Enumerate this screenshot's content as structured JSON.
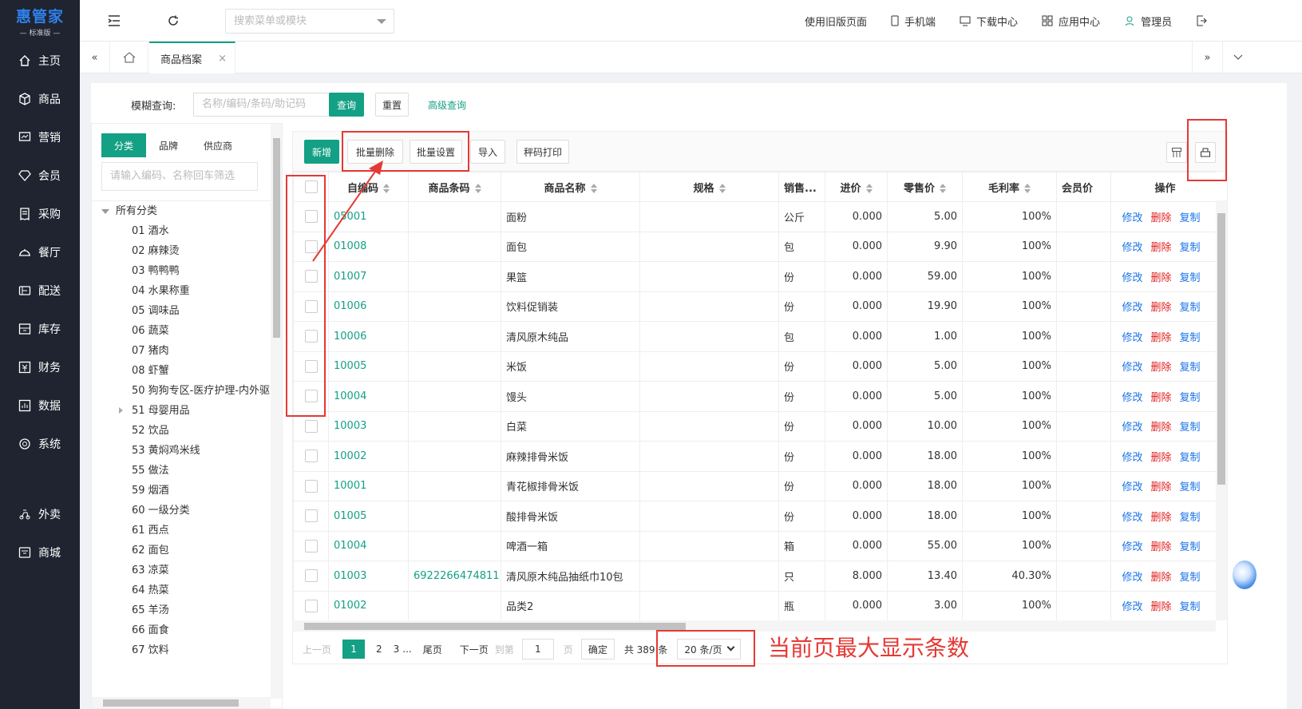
{
  "logo": {
    "main": "惠管家",
    "sub": "— 标准版 —"
  },
  "sidebar": {
    "items": [
      {
        "label": "主页",
        "icon": "home-icon"
      },
      {
        "label": "商品",
        "icon": "box-icon"
      },
      {
        "label": "营销",
        "icon": "chart-icon"
      },
      {
        "label": "会员",
        "icon": "diamond-icon"
      },
      {
        "label": "采购",
        "icon": "receipt-icon"
      },
      {
        "label": "餐厅",
        "icon": "dish-icon"
      },
      {
        "label": "配送",
        "icon": "delivery-icon"
      },
      {
        "label": "库存",
        "icon": "inventory-icon"
      },
      {
        "label": "财务",
        "icon": "finance-icon"
      },
      {
        "label": "数据",
        "icon": "data-icon"
      },
      {
        "label": "系统",
        "icon": "settings-icon"
      }
    ],
    "extra_items": [
      {
        "label": "外卖",
        "icon": "takeout-icon"
      },
      {
        "label": "商城",
        "icon": "mall-icon"
      }
    ]
  },
  "topbar": {
    "menu_search_placeholder": "搜索菜单或模块",
    "old_version": "使用旧版页面",
    "mobile": "手机端",
    "download": "下载中心",
    "apps": "应用中心",
    "user": "管理员"
  },
  "tabs": {
    "active": "商品档案",
    "close": "×"
  },
  "search": {
    "label": "模糊查询:",
    "placeholder": "名称/编码/条码/助记码",
    "query": "查询",
    "reset": "重置",
    "advanced": "高级查询"
  },
  "category_panel": {
    "tabs": [
      "分类",
      "品牌",
      "供应商"
    ],
    "filter_placeholder": "请输入编码、名称回车筛选",
    "root": "所有分类",
    "items": [
      "01 酒水",
      "02 麻辣烫",
      "03 鸭鸭鸭",
      "04 水果称重",
      "05 调味品",
      "06 蔬菜",
      "07 猪肉",
      "08 虾蟹",
      "50 狗狗专区-医疗护理-内外驱",
      "51 母婴用品",
      "52 饮品",
      "53 黄焖鸡米线",
      "55 做法",
      "59 烟酒",
      "60 一级分类",
      "61 西点",
      "62 面包",
      "63 凉菜",
      "64 热菜",
      "65 羊汤",
      "66 面食",
      "67 饮料"
    ]
  },
  "toolbar": {
    "add": "新增",
    "batch_delete": "批量删除",
    "batch_set": "批量设置",
    "import": "导入",
    "scale_print": "秤码打印"
  },
  "table": {
    "headers": {
      "code": "自编码",
      "barcode": "商品条码",
      "name": "商品名称",
      "spec": "规格",
      "unit": "销售...",
      "cost": "进价",
      "price": "零售价",
      "margin": "毛利率",
      "member": "会员价",
      "ops": "操作"
    },
    "ops": {
      "edit": "修改",
      "delete": "删除",
      "copy": "复制"
    },
    "rows": [
      {
        "code": "05001",
        "barcode": "",
        "name": "面粉",
        "spec": "",
        "unit": "公斤",
        "cost": "0.000",
        "price": "5.00",
        "margin": "100%"
      },
      {
        "code": "01008",
        "barcode": "",
        "name": "面包",
        "spec": "",
        "unit": "包",
        "cost": "0.000",
        "price": "9.90",
        "margin": "100%"
      },
      {
        "code": "01007",
        "barcode": "",
        "name": "果篮",
        "spec": "",
        "unit": "份",
        "cost": "0.000",
        "price": "59.00",
        "margin": "100%"
      },
      {
        "code": "01006",
        "barcode": "",
        "name": "饮料促销装",
        "spec": "",
        "unit": "份",
        "cost": "0.000",
        "price": "19.90",
        "margin": "100%"
      },
      {
        "code": "10006",
        "barcode": "",
        "name": "清风原木纯品",
        "spec": "",
        "unit": "包",
        "cost": "0.000",
        "price": "1.00",
        "margin": "100%"
      },
      {
        "code": "10005",
        "barcode": "",
        "name": "米饭",
        "spec": "",
        "unit": "份",
        "cost": "0.000",
        "price": "5.00",
        "margin": "100%"
      },
      {
        "code": "10004",
        "barcode": "",
        "name": "馒头",
        "spec": "",
        "unit": "份",
        "cost": "0.000",
        "price": "5.00",
        "margin": "100%"
      },
      {
        "code": "10003",
        "barcode": "",
        "name": "白菜",
        "spec": "",
        "unit": "份",
        "cost": "0.000",
        "price": "10.00",
        "margin": "100%"
      },
      {
        "code": "10002",
        "barcode": "",
        "name": "麻辣排骨米饭",
        "spec": "",
        "unit": "份",
        "cost": "0.000",
        "price": "18.00",
        "margin": "100%"
      },
      {
        "code": "10001",
        "barcode": "",
        "name": "青花椒排骨米饭",
        "spec": "",
        "unit": "份",
        "cost": "0.000",
        "price": "18.00",
        "margin": "100%"
      },
      {
        "code": "01005",
        "barcode": "",
        "name": "酸排骨米饭",
        "spec": "",
        "unit": "份",
        "cost": "0.000",
        "price": "18.00",
        "margin": "100%"
      },
      {
        "code": "01004",
        "barcode": "",
        "name": "啤酒一箱",
        "spec": "",
        "unit": "箱",
        "cost": "0.000",
        "price": "55.00",
        "margin": "100%"
      },
      {
        "code": "01003",
        "barcode": "6922266474811",
        "name": "清风原木纯品抽纸巾10包",
        "spec": "",
        "unit": "只",
        "cost": "8.000",
        "price": "13.40",
        "margin": "40.30%"
      },
      {
        "code": "01002",
        "barcode": "",
        "name": "品类2",
        "spec": "",
        "unit": "瓶",
        "cost": "0.000",
        "price": "3.00",
        "margin": "100%"
      }
    ]
  },
  "pager": {
    "prev": "上一页",
    "current": "1",
    "p2": "2",
    "p3": "3",
    "ellipsis": "...",
    "last": "尾页",
    "next": "下一页",
    "goto": "到第",
    "goto_value": "1",
    "page_unit": "页",
    "confirm": "确定",
    "total": "共 389 条",
    "page_size": "20 条/页"
  },
  "annotation": {
    "text": "当前页最大显示条数"
  }
}
